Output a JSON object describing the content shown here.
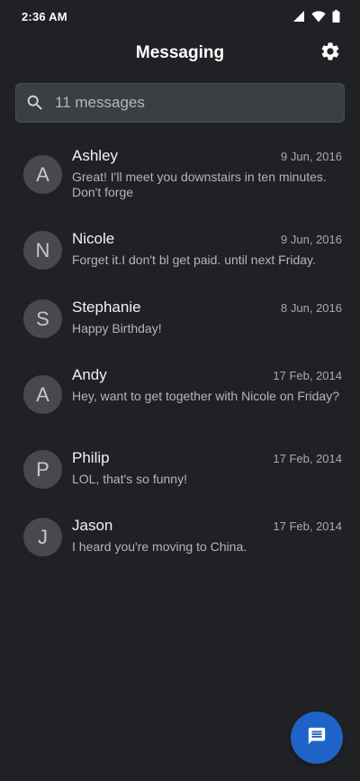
{
  "status_bar": {
    "time": "2:36 AM",
    "icons": [
      "signal-icon",
      "wifi-icon",
      "battery-icon"
    ]
  },
  "header": {
    "title": "Messaging",
    "settings_icon": "gear-icon"
  },
  "search": {
    "placeholder": "11 messages",
    "icon": "search-icon"
  },
  "conversations": [
    {
      "initial": "A",
      "name": "Ashley",
      "date": "9 Jun, 2016",
      "snippet": "Great! I'll meet you downstairs in ten minutes. Don't forge"
    },
    {
      "initial": "N",
      "name": "Nicole",
      "date": "9 Jun, 2016",
      "snippet": "Forget it.I don't bl get paid. until next Friday."
    },
    {
      "initial": "S",
      "name": "Stephanie",
      "date": "8 Jun, 2016",
      "snippet": "Happy Birthday!"
    },
    {
      "initial": "A",
      "name": "Andy",
      "date": "17 Feb, 2014",
      "snippet": "Hey, want to get together with Nicole on Friday?"
    },
    {
      "initial": "P",
      "name": "Philip",
      "date": "17 Feb, 2014",
      "snippet": "LOL, that's so funny!"
    },
    {
      "initial": "J",
      "name": "Jason",
      "date": "17 Feb, 2014",
      "snippet": "I heard you're moving to China."
    }
  ],
  "fab": {
    "icon": "new-message-icon"
  },
  "colors": {
    "background": "#202125",
    "search_background": "#3b3e43",
    "avatar_background": "#47494e",
    "fab": "#1f62c8"
  }
}
